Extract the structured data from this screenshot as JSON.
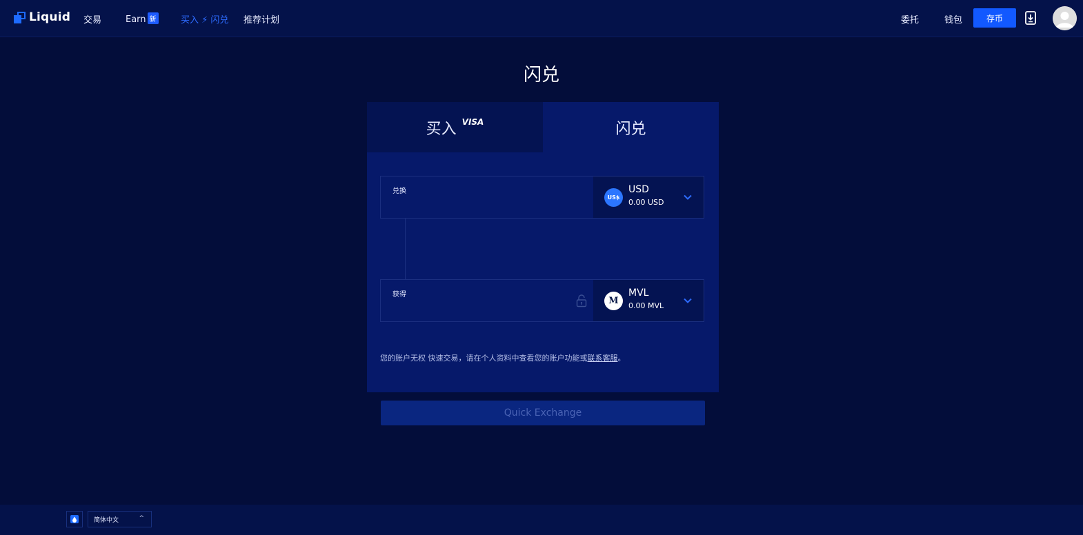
{
  "nav": {
    "brand": "Liquid",
    "links": [
      {
        "label": "交易"
      },
      {
        "label": "Earn",
        "badge": "新"
      },
      {
        "label": "买入 ⚡ 闪兑"
      },
      {
        "label": "推荐计划"
      }
    ],
    "right_links": [
      {
        "label": "委托"
      },
      {
        "label": "钱包"
      }
    ],
    "deposit_button": "存币",
    "download_icon": "mobile-download-icon",
    "avatar_icon": "user-avatar-icon"
  },
  "page": {
    "title": "闪兑"
  },
  "tabs": {
    "buy": "买入",
    "visa": "VISA",
    "swap": "闪兑"
  },
  "from": {
    "label": "兑换",
    "coin_badge": "US$",
    "currency": "USD",
    "balance": "0.00 USD"
  },
  "to": {
    "label": "获得",
    "coin_badge": "M",
    "currency": "MVL",
    "balance": "0.00 MVL"
  },
  "notice": {
    "text": "您的账户无权 快速交易，请在个人资料中查看您的账户功能或",
    "link": "联系客服",
    "suffix": "。"
  },
  "quick_exchange_button": "Quick Exchange",
  "footer": {
    "language": "简体中文",
    "caret": "^"
  },
  "colors": {
    "background": "#030d3a",
    "card": "#06196a",
    "accent": "#1259ff",
    "active_link": "#2d6bff"
  }
}
